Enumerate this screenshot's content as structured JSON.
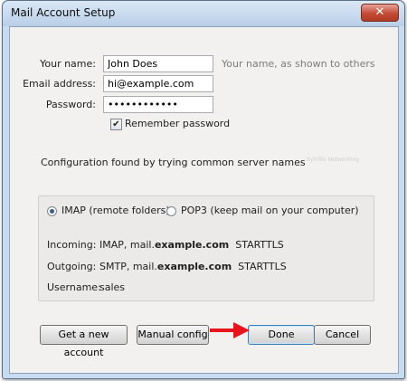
{
  "window": {
    "title": "Mail Account Setup",
    "close_glyph": "✕"
  },
  "form": {
    "name_label": "Your name:",
    "name_value": "John Does",
    "name_hint": "Your name, as shown to others",
    "email_label": "Email address:",
    "email_value": "hi@example.com",
    "password_label": "Password:",
    "password_value": "••••••••••••",
    "remember_label": "Remember password",
    "remember_checked": true
  },
  "status_text": "Configuration found by trying common server names",
  "watermark_text": "Sylvlife Networking",
  "protocol": {
    "imap_label": "IMAP (remote folders)",
    "pop3_label": "POP3 (keep mail on your computer)",
    "selected": "IMAP"
  },
  "server_info": {
    "incoming_label": "Incoming:",
    "incoming_proto": "IMAP, mail.",
    "incoming_host": "example.com",
    "incoming_security": "STARTTLS",
    "outgoing_label": "Outgoing:",
    "outgoing_proto": "SMTP, mail.",
    "outgoing_host": "example.com",
    "outgoing_security": "STARTTLS",
    "username_label": "Username:",
    "username_value": "sales"
  },
  "buttons": {
    "new_account": "Get a new account",
    "manual_config": "Manual config",
    "done": "Done",
    "cancel": "Cancel"
  },
  "colors": {
    "arrow": "#e8141b",
    "title_bar": "#c9dcef",
    "close_button": "#c34a35"
  }
}
